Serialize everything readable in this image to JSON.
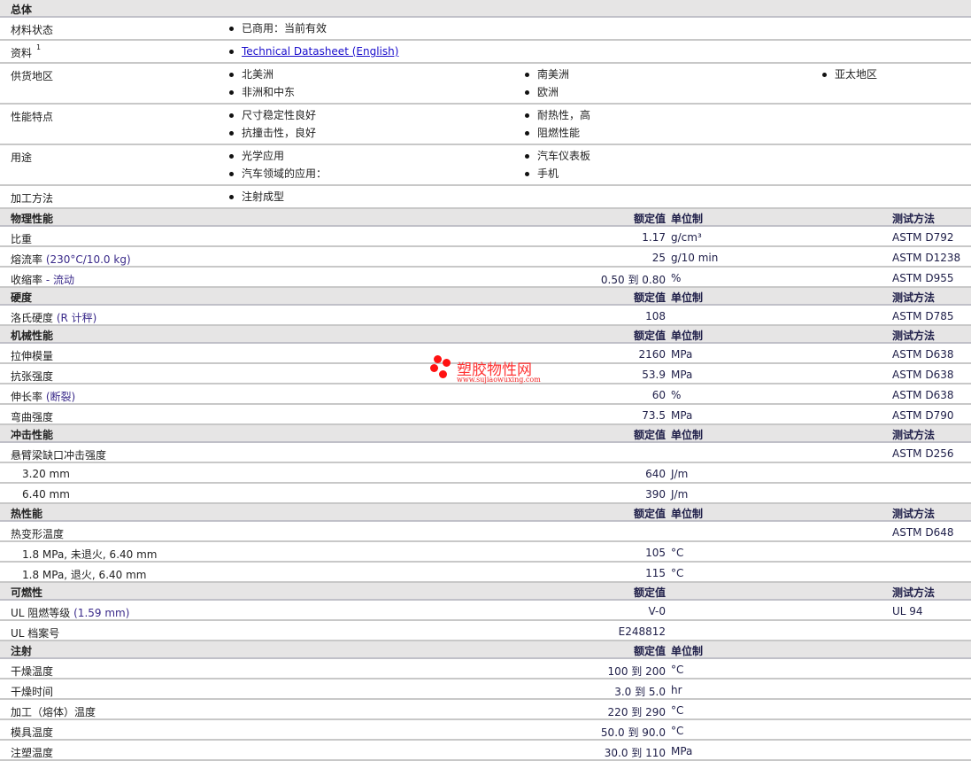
{
  "general": {
    "title": "总体",
    "rows": [
      {
        "label": "材料状态",
        "items": [
          "已商用：当前有效"
        ]
      },
      {
        "label": "资料",
        "sup": "1",
        "items": [
          "Technical Datasheet (English)"
        ],
        "link": true
      },
      {
        "label": "供货地区",
        "items": [
          "北美洲",
          "南美洲",
          "亚太地区",
          "非洲和中东",
          "欧洲"
        ]
      },
      {
        "label": "性能特点",
        "items": [
          "尺寸稳定性良好",
          "耐热性，高",
          "抗撞击性，良好",
          "阻燃性能"
        ]
      },
      {
        "label": "用途",
        "items": [
          "光学应用",
          "汽车仪表板",
          "汽车领域的应用：",
          "手机"
        ]
      },
      {
        "label": "加工方法",
        "items": [
          "注射成型"
        ]
      }
    ]
  },
  "columns": {
    "nominal": "额定值",
    "unit": "单位制",
    "method": "测试方法"
  },
  "sections": [
    {
      "title": "物理性能",
      "unit_col": true,
      "method_col": true,
      "rows": [
        {
          "label": "比重",
          "value": "1.17",
          "unit": "g/cm³",
          "method": "ASTM D792"
        },
        {
          "label": "熔流率",
          "note": "(230°C/10.0 kg)",
          "value": "25",
          "unit": "g/10 min",
          "method": "ASTM D1238"
        },
        {
          "label": "收缩率",
          "note": "- 流动",
          "value": "0.50 到  0.80",
          "unit": "%",
          "method": "ASTM D955"
        }
      ]
    },
    {
      "title": "硬度",
      "unit_col": true,
      "method_col": true,
      "rows": [
        {
          "label": "洛氏硬度",
          "note": "(R 计秤)",
          "value": "108",
          "unit": "",
          "method": "ASTM D785"
        }
      ]
    },
    {
      "title": "机械性能",
      "unit_col": true,
      "method_col": true,
      "rows": [
        {
          "label": "拉伸模量",
          "value": "2160",
          "unit": "MPa",
          "method": "ASTM D638"
        },
        {
          "label": "抗张强度",
          "value": "53.9",
          "unit": "MPa",
          "method": "ASTM D638"
        },
        {
          "label": "伸长率",
          "note": "(断裂)",
          "value": "60",
          "unit": "%",
          "method": "ASTM D638"
        },
        {
          "label": "弯曲强度",
          "value": "73.5",
          "unit": "MPa",
          "method": "ASTM D790"
        }
      ]
    },
    {
      "title": "冲击性能",
      "unit_col": true,
      "method_col": true,
      "rows": [
        {
          "label": "悬臂梁缺口冲击强度",
          "value": "",
          "unit": "",
          "method": "ASTM D256"
        },
        {
          "label": "3.20 mm",
          "sub": true,
          "value": "640",
          "unit": "J/m",
          "method": ""
        },
        {
          "label": "6.40 mm",
          "sub": true,
          "value": "390",
          "unit": "J/m",
          "method": ""
        }
      ]
    },
    {
      "title": "热性能",
      "unit_col": true,
      "method_col": true,
      "rows": [
        {
          "label": "热变形温度",
          "value": "",
          "unit": "",
          "method": "ASTM D648"
        },
        {
          "label": "1.8 MPa, 未退火, 6.40 mm",
          "sub": true,
          "value": "105",
          "unit": "°C",
          "method": ""
        },
        {
          "label": "1.8 MPa, 退火, 6.40 mm",
          "sub": true,
          "value": "115",
          "unit": "°C",
          "method": ""
        }
      ]
    },
    {
      "title": "可燃性",
      "unit_col": false,
      "method_col": true,
      "rows": [
        {
          "label": "UL 阻燃等级",
          "note": "(1.59 mm)",
          "value": "V-0",
          "unit": "",
          "method": "UL 94"
        },
        {
          "label": "UL 档案号",
          "value": "E248812",
          "unit": "",
          "method": ""
        }
      ]
    },
    {
      "title": "注射",
      "unit_col": true,
      "method_col": false,
      "rows": [
        {
          "label": "干燥温度",
          "value": "100 到  200",
          "unit": "°C",
          "method": ""
        },
        {
          "label": "干燥时间",
          "value": "3.0 到  5.0",
          "unit": "hr",
          "method": ""
        },
        {
          "label": "加工（熔体）温度",
          "value": "220 到  290",
          "unit": "°C",
          "method": ""
        },
        {
          "label": "模具温度",
          "value": "50.0 到  90.0",
          "unit": "°C",
          "method": ""
        },
        {
          "label": "注塑温度",
          "value": "30.0 到  110",
          "unit": "MPa",
          "method": ""
        }
      ]
    }
  ],
  "watermark": {
    "name": "塑胶物性网",
    "url": "www.sujiaowuxing.com"
  }
}
